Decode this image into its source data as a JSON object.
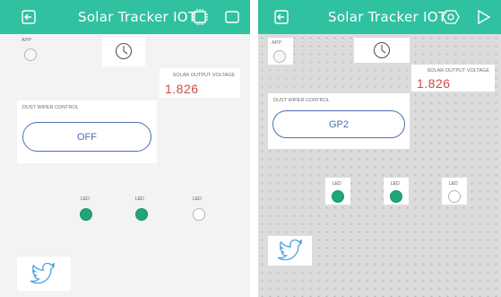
{
  "app": {
    "title": "Solar Tracker IOT",
    "colors": {
      "accent": "#2fc1a0",
      "value": "#d14848",
      "button": "#4a6fb3",
      "led_on": "#1fa67b"
    }
  },
  "left_panel": {
    "mode": "run",
    "header_icons": {
      "back": "exit-icon",
      "board": "chip-icon",
      "action": "stop-square-icon"
    },
    "app_label": "APP",
    "clock_icon": "clock-icon",
    "voltage": {
      "label": "SOLAR OUTPUT VOLTAGE",
      "value": "1.826"
    },
    "wiper": {
      "label": "DUST WIPER CONTROL",
      "button": "OFF"
    },
    "leds": [
      {
        "label": "LED",
        "state": "on"
      },
      {
        "label": "LED",
        "state": "on"
      },
      {
        "label": "LED",
        "state": "off"
      }
    ],
    "twitter_icon": "twitter-icon"
  },
  "right_panel": {
    "mode": "edit",
    "header_icons": {
      "back": "exit-icon",
      "settings": "hexagon-settings-icon",
      "play": "play-icon"
    },
    "app_label": "APP",
    "clock_icon": "clock-icon",
    "voltage": {
      "label": "SOLAR OUTPUT VOLTAGE",
      "value": "1.826"
    },
    "wiper": {
      "label": "DUST WIPER CONTROL",
      "button": "GP2"
    },
    "leds": [
      {
        "label": "LED",
        "state": "on"
      },
      {
        "label": "LED",
        "state": "on"
      },
      {
        "label": "LED",
        "state": "off"
      }
    ],
    "twitter_icon": "twitter-icon"
  }
}
